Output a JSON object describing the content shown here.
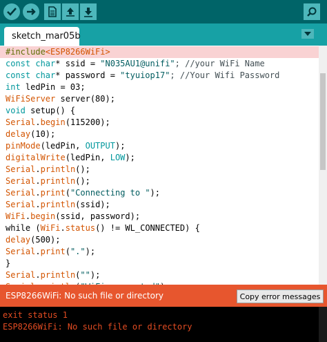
{
  "toolbar": {
    "buttons": [
      "verify",
      "upload",
      "new",
      "open",
      "save",
      "serial-monitor"
    ]
  },
  "tabs": [
    {
      "label": "sketch_mar05b"
    }
  ],
  "code": [
    [
      {
        "t": "#include",
        "c": "inc"
      },
      {
        "t": "<ESP8266WiFi>",
        "c": "kw"
      }
    ],
    [
      {
        "t": "const char",
        "c": "ty"
      },
      {
        "t": "* ssid = ",
        "c": ""
      },
      {
        "t": "\"N035AU1@unifi\"",
        "c": "str"
      },
      {
        "t": "; //your WiFi Name",
        "c": "cm"
      }
    ],
    [
      {
        "t": "const char",
        "c": "ty"
      },
      {
        "t": "* password = ",
        "c": ""
      },
      {
        "t": "\"tyuiop17\"",
        "c": "str"
      },
      {
        "t": "; //Your Wifi Password",
        "c": "cm"
      }
    ],
    [
      {
        "t": "int",
        "c": "ty"
      },
      {
        "t": " ledPin = 03;",
        "c": ""
      }
    ],
    [
      {
        "t": "WiFiServer",
        "c": "kw"
      },
      {
        "t": " server(80);",
        "c": ""
      }
    ],
    [
      {
        "t": "void",
        "c": "ty"
      },
      {
        "t": " setup() {",
        "c": ""
      }
    ],
    [
      {
        "t": "Serial",
        "c": "kw"
      },
      {
        "t": ".",
        "c": ""
      },
      {
        "t": "begin",
        "c": "kw"
      },
      {
        "t": "(115200);",
        "c": ""
      }
    ],
    [
      {
        "t": "delay",
        "c": "kw"
      },
      {
        "t": "(10);",
        "c": ""
      }
    ],
    [
      {
        "t": "pinMode",
        "c": "kw"
      },
      {
        "t": "(ledPin, ",
        "c": ""
      },
      {
        "t": "OUTPUT",
        "c": "ty"
      },
      {
        "t": ");",
        "c": ""
      }
    ],
    [
      {
        "t": "digitalWrite",
        "c": "kw"
      },
      {
        "t": "(ledPin, ",
        "c": ""
      },
      {
        "t": "LOW",
        "c": "ty"
      },
      {
        "t": ");",
        "c": ""
      }
    ],
    [
      {
        "t": "Serial",
        "c": "kw"
      },
      {
        "t": ".",
        "c": ""
      },
      {
        "t": "println",
        "c": "kw"
      },
      {
        "t": "();",
        "c": ""
      }
    ],
    [
      {
        "t": "Serial",
        "c": "kw"
      },
      {
        "t": ".",
        "c": ""
      },
      {
        "t": "println",
        "c": "kw"
      },
      {
        "t": "();",
        "c": ""
      }
    ],
    [
      {
        "t": "Serial",
        "c": "kw"
      },
      {
        "t": ".",
        "c": ""
      },
      {
        "t": "print",
        "c": "kw"
      },
      {
        "t": "(",
        "c": ""
      },
      {
        "t": "\"Connecting to \"",
        "c": "str"
      },
      {
        "t": ");",
        "c": ""
      }
    ],
    [
      {
        "t": "Serial",
        "c": "kw"
      },
      {
        "t": ".",
        "c": ""
      },
      {
        "t": "println",
        "c": "kw"
      },
      {
        "t": "(ssid);",
        "c": ""
      }
    ],
    [
      {
        "t": "WiFi",
        "c": "kw"
      },
      {
        "t": ".",
        "c": ""
      },
      {
        "t": "begin",
        "c": "kw"
      },
      {
        "t": "(ssid, password);",
        "c": ""
      }
    ],
    [
      {
        "t": "while (",
        "c": ""
      },
      {
        "t": "WiFi",
        "c": "kw"
      },
      {
        "t": ".",
        "c": ""
      },
      {
        "t": "status",
        "c": "kw"
      },
      {
        "t": "() != WL_CONNECTED) {",
        "c": ""
      }
    ],
    [
      {
        "t": "delay",
        "c": "kw"
      },
      {
        "t": "(500);",
        "c": ""
      }
    ],
    [
      {
        "t": "Serial",
        "c": "kw"
      },
      {
        "t": ".",
        "c": ""
      },
      {
        "t": "print",
        "c": "kw"
      },
      {
        "t": "(",
        "c": ""
      },
      {
        "t": "\".\"",
        "c": "str"
      },
      {
        "t": ");",
        "c": ""
      }
    ],
    [
      {
        "t": "}",
        "c": ""
      }
    ],
    [
      {
        "t": "Serial",
        "c": "kw"
      },
      {
        "t": ".",
        "c": ""
      },
      {
        "t": "println",
        "c": "kw"
      },
      {
        "t": "(",
        "c": ""
      },
      {
        "t": "\"\"",
        "c": "str"
      },
      {
        "t": ");",
        "c": ""
      }
    ],
    [
      {
        "t": "Serial",
        "c": "kw"
      },
      {
        "t": ".",
        "c": ""
      },
      {
        "t": "println",
        "c": "kw"
      },
      {
        "t": "(",
        "c": ""
      },
      {
        "t": "\"WiFi connected\"",
        "c": "str"
      },
      {
        "t": ");",
        "c": ""
      }
    ]
  ],
  "highlighted_line": 0,
  "error_bar": {
    "message": "ESP8266WiFi: No such file or directory",
    "copy_button": "Copy error messages"
  },
  "console": {
    "lines": [
      "exit status 1",
      "ESP8266WiFi: No such file or directory"
    ]
  },
  "colors": {
    "toolbar_bg": "#006468",
    "tabbar_bg": "#17a1a5",
    "button": "#4db7bb",
    "error_bar": "#e7562e",
    "console_text": "#e34c22"
  }
}
